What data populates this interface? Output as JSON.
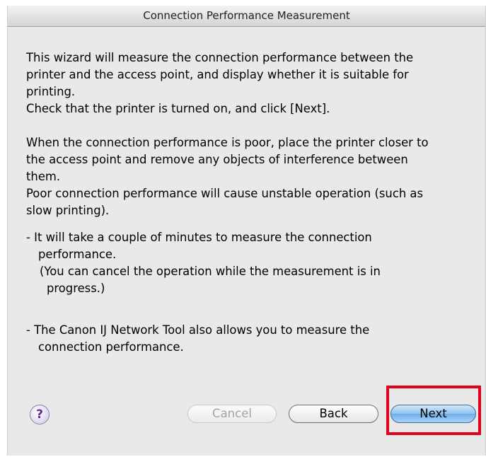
{
  "window": {
    "title": "Connection Performance Measurement"
  },
  "content": {
    "paragraph1_line1": "This wizard will measure the connection performance between the",
    "paragraph1_line2": "printer and the access point, and display whether it is suitable for",
    "paragraph1_line3": "printing.",
    "paragraph1_line4": "Check that the printer is turned on, and click [Next].",
    "paragraph2_line1": "When the connection performance is poor, place the printer closer to",
    "paragraph2_line2": "the access point and remove any objects of interference between",
    "paragraph2_line3": "them.",
    "paragraph2_line4": "Poor connection performance will cause unstable operation (such as",
    "paragraph2_line5": "slow printing).",
    "bullet1_line1": "- It will take a couple of minutes to measure the connection",
    "bullet1_line2": "performance.",
    "bullet1_sub_line1": "(You can cancel the operation while the measurement is in",
    "bullet1_sub_line2": "progress.)",
    "bullet2_line1": "- The Canon IJ Network Tool also allows you to measure the",
    "bullet2_line2": "connection performance."
  },
  "buttons": {
    "help_label": "?",
    "cancel_label": "Cancel",
    "back_label": "Back",
    "next_label": "Next"
  },
  "colors": {
    "highlight": "#e3001b",
    "default_button": "#8ec3ef",
    "help_icon": "#5b2c8e"
  }
}
